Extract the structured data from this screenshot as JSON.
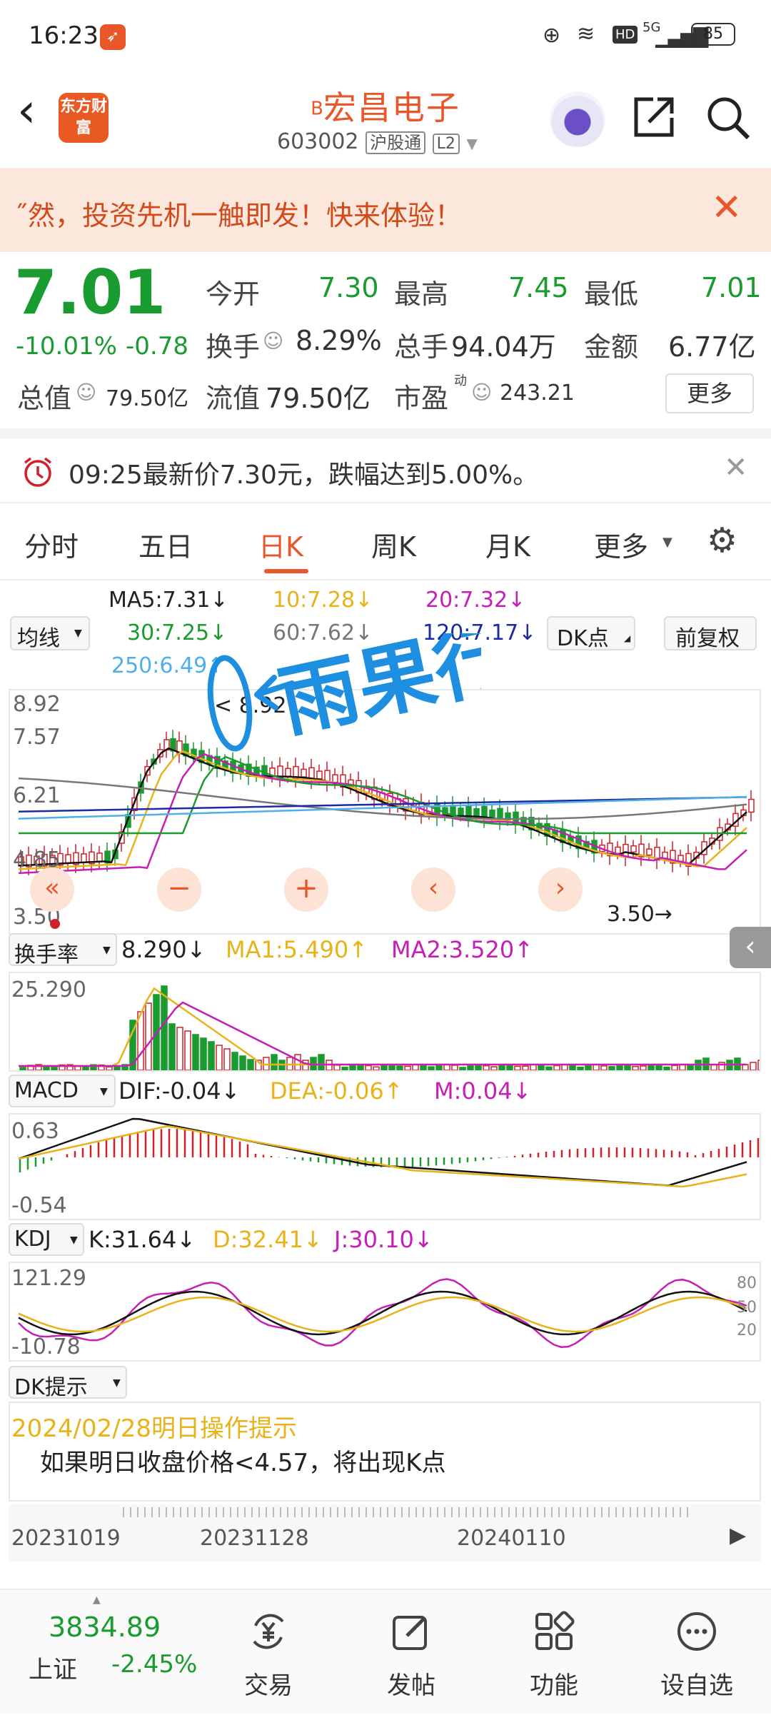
{
  "status_bar": {
    "time": "16:23",
    "battery": "85",
    "network": "5G"
  },
  "header": {
    "logo_text": "东方财富",
    "title_prefix": "B",
    "title": "宏昌电子",
    "code": "603002",
    "market_tag": "沪股通",
    "level_tag": "L2"
  },
  "banner": {
    "text": "˝然，投资先机一触即发！快来体验！"
  },
  "quote": {
    "price": "7.01",
    "change_pct": "-10.01%",
    "change": "-0.78",
    "open_label": "今开",
    "open": "7.30",
    "high_label": "最高",
    "high": "7.45",
    "low_label": "最低",
    "low": "7.01",
    "turnover_label": "换手",
    "turnover": "8.29%",
    "volume_label": "总手",
    "volume": "94.04万",
    "amount_label": "金额",
    "amount": "6.77亿",
    "mktcap_label": "总值",
    "mktcap": "79.50亿",
    "float_label": "流值",
    "float": "79.50亿",
    "pe_label": "市盈",
    "pe_sup": "动",
    "pe": "243.21",
    "more_button": "更多"
  },
  "alert": {
    "text": "09:25最新价7.30元，跌幅达到5.00%。"
  },
  "tabs": [
    {
      "label": "分时"
    },
    {
      "label": "五日"
    },
    {
      "label": "日K",
      "active": true
    },
    {
      "label": "周K"
    },
    {
      "label": "月K"
    },
    {
      "label": "更多"
    }
  ],
  "ma": {
    "selector": "均线",
    "ma5": "MA5:7.31↓",
    "ma10": "10:7.28↓",
    "ma20": "20:7.32↓",
    "ma30": "30:7.25↓",
    "ma60": "60:7.62↓",
    "ma120": "120:7.17↓",
    "ma250": "250:6.49↑",
    "dk_button": "DK点",
    "adjust_button": "前复权"
  },
  "kline": {
    "y_labels": [
      "8.92",
      "7.57",
      "6.21",
      "4.85",
      "3.50"
    ],
    "max_label": "8.92",
    "min_label": "3.50",
    "handwriting": "雨果行",
    "colors": {
      "up": "#d0202a",
      "down": "#1a9b2f",
      "ma5": "#111111",
      "ma10": "#e8b21a",
      "ma20": "#c51fb5",
      "ma30": "#1a9b2f",
      "ma60": "#777777",
      "ma120": "#1d2aa0",
      "ma250": "#4fb0e8"
    }
  },
  "turnover_panel": {
    "selector": "换手率",
    "value": "8.290↓",
    "ma1": "MA1:5.490↑",
    "ma2": "MA2:3.520↑",
    "max": "25.290"
  },
  "macd_panel": {
    "selector": "MACD",
    "dif": "DIF:-0.04↓",
    "dea": "DEA:-0.06↑",
    "m": "M:0.04↓",
    "top": "0.63",
    "bottom": "-0.54"
  },
  "kdj_panel": {
    "selector": "KDJ",
    "k": "K:31.64↓",
    "d": "D:32.41↓",
    "j": "J:30.10↓",
    "top": "121.29",
    "bottom": "-10.78",
    "r80": "80",
    "r50": "50",
    "r20": "20"
  },
  "dk_panel": {
    "selector": "DK提示",
    "date_line": "2024/02/28明日操作提示",
    "text": "如果明日收盘价格<4.57，将出现K点"
  },
  "timeline": {
    "dates": [
      "20231019",
      "20231128",
      "20240110"
    ]
  },
  "bottom_nav": {
    "index_value": "3834.89",
    "index_name": "上证",
    "index_change": "-2.45%",
    "items": [
      {
        "label": "交易"
      },
      {
        "label": "发帖"
      },
      {
        "label": "功能"
      },
      {
        "label": "设自选"
      }
    ]
  }
}
